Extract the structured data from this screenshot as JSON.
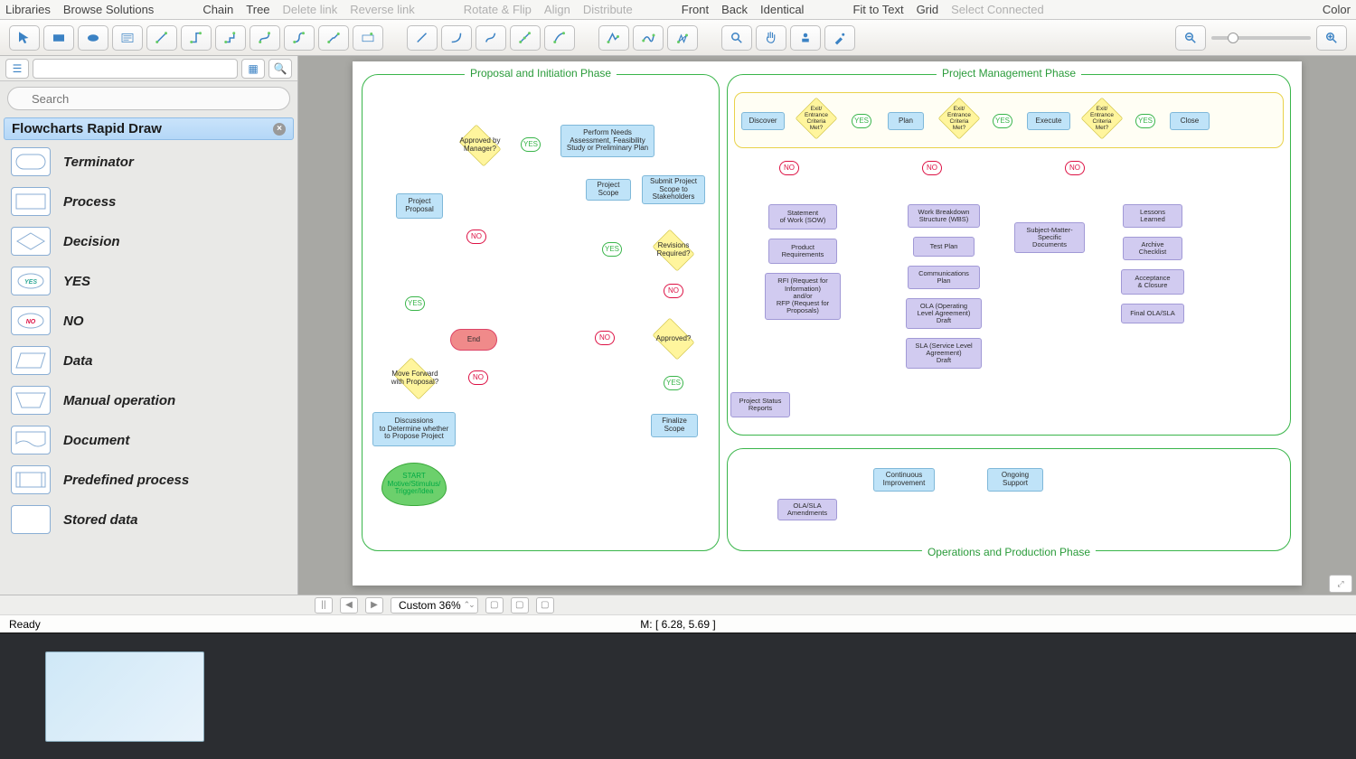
{
  "menubar": {
    "left": [
      "Libraries",
      "Browse Solutions"
    ],
    "g1": [
      "Chain",
      "Tree"
    ],
    "g1dim": [
      "Delete link",
      "Reverse link"
    ],
    "g2dim": [
      "Rotate & Flip",
      "Align",
      "Distribute"
    ],
    "g3": [
      "Front",
      "Back",
      "Identical"
    ],
    "g4": [
      "Fit to Text",
      "Grid"
    ],
    "g4dim": [
      "Select Connected"
    ],
    "right": [
      "Color"
    ]
  },
  "search_placeholder": "Search",
  "lib_header": "Flowcharts Rapid Draw",
  "lib_items": [
    "Terminator",
    "Process",
    "Decision",
    "YES",
    "NO",
    "Data",
    "Manual operation",
    "Document",
    "Predefined process",
    "Stored data"
  ],
  "phases": {
    "p1": "Proposal and Initiation Phase",
    "p2": "Project Management Phase",
    "p3": "Operations and Production Phase"
  },
  "nodes": {
    "start": "START\nMotive/Stimulus/\nTrigger/Idea",
    "discuss": "Discussions\nto Determine whether\nto Propose Project",
    "moveFwd": "Move Forward\nwith Proposal?",
    "projProp": "Project\nProposal",
    "apprMgr": "Approved by\nManager?",
    "needs": "Perform Needs\nAssessment, Feasibility\nStudy or Preliminary Plan",
    "end": "End",
    "scope": "Project\nScope",
    "submit": "Submit Project\nScope to\nStakeholders",
    "revReq": "Revisions\nRequired?",
    "approved": "Approved?",
    "finalize": "Finalize\nScope",
    "discover": "Discover",
    "plan": "Plan",
    "execute": "Execute",
    "close": "Close",
    "exitCrit": "Exit/\nEntrance\nCriteria\nMet?",
    "sow": "Statement\nof Work (SOW)",
    "prodReq": "Product\nRequirements",
    "rfi": "RFI (Request for\nInformation)\nand/or\nRFP (Request for\nProposals)",
    "statusRep": "Project Status\nReports",
    "wbs": "Work Breakdown\nStructure (WBS)",
    "testPlan": "Test Plan",
    "commPlan": "Communications\nPlan",
    "ola": "OLA (Operating\nLevel Agreement)\nDraft",
    "sla": "SLA (Service Level\nAgreement)\nDraft",
    "smeDocs": "Subject-Matter-\nSpecific\nDocuments",
    "lessons": "Lessons\nLearned",
    "archive": "Archive\nChecklist",
    "accept": "Acceptance\n& Closure",
    "finalOla": "Final OLA/SLA",
    "contImp": "Continuous\nImprovement",
    "ongoing": "Ongoing\nSupport",
    "olaAmend": "OLA/SLA\nAmendments"
  },
  "yn": {
    "yes": "YES",
    "no": "NO"
  },
  "zoom_label": "Custom 36%",
  "status_ready": "Ready",
  "status_coords": "M: [ 6.28, 5.69 ]"
}
